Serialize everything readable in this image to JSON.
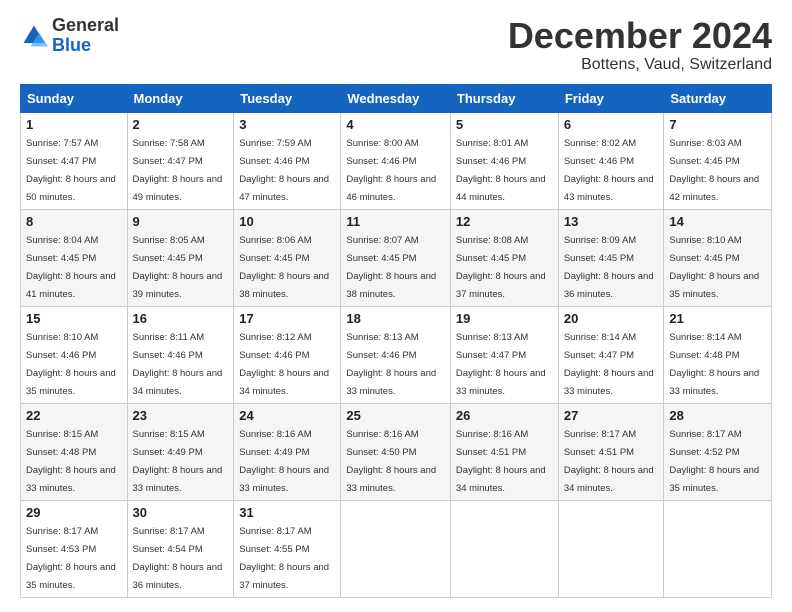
{
  "logo": {
    "general": "General",
    "blue": "Blue"
  },
  "title": {
    "month": "December 2024",
    "location": "Bottens, Vaud, Switzerland"
  },
  "weekdays": [
    "Sunday",
    "Monday",
    "Tuesday",
    "Wednesday",
    "Thursday",
    "Friday",
    "Saturday"
  ],
  "weeks": [
    [
      {
        "day": "1",
        "sunrise": "Sunrise: 7:57 AM",
        "sunset": "Sunset: 4:47 PM",
        "daylight": "Daylight: 8 hours and 50 minutes."
      },
      {
        "day": "2",
        "sunrise": "Sunrise: 7:58 AM",
        "sunset": "Sunset: 4:47 PM",
        "daylight": "Daylight: 8 hours and 49 minutes."
      },
      {
        "day": "3",
        "sunrise": "Sunrise: 7:59 AM",
        "sunset": "Sunset: 4:46 PM",
        "daylight": "Daylight: 8 hours and 47 minutes."
      },
      {
        "day": "4",
        "sunrise": "Sunrise: 8:00 AM",
        "sunset": "Sunset: 4:46 PM",
        "daylight": "Daylight: 8 hours and 46 minutes."
      },
      {
        "day": "5",
        "sunrise": "Sunrise: 8:01 AM",
        "sunset": "Sunset: 4:46 PM",
        "daylight": "Daylight: 8 hours and 44 minutes."
      },
      {
        "day": "6",
        "sunrise": "Sunrise: 8:02 AM",
        "sunset": "Sunset: 4:46 PM",
        "daylight": "Daylight: 8 hours and 43 minutes."
      },
      {
        "day": "7",
        "sunrise": "Sunrise: 8:03 AM",
        "sunset": "Sunset: 4:45 PM",
        "daylight": "Daylight: 8 hours and 42 minutes."
      }
    ],
    [
      {
        "day": "8",
        "sunrise": "Sunrise: 8:04 AM",
        "sunset": "Sunset: 4:45 PM",
        "daylight": "Daylight: 8 hours and 41 minutes."
      },
      {
        "day": "9",
        "sunrise": "Sunrise: 8:05 AM",
        "sunset": "Sunset: 4:45 PM",
        "daylight": "Daylight: 8 hours and 39 minutes."
      },
      {
        "day": "10",
        "sunrise": "Sunrise: 8:06 AM",
        "sunset": "Sunset: 4:45 PM",
        "daylight": "Daylight: 8 hours and 38 minutes."
      },
      {
        "day": "11",
        "sunrise": "Sunrise: 8:07 AM",
        "sunset": "Sunset: 4:45 PM",
        "daylight": "Daylight: 8 hours and 38 minutes."
      },
      {
        "day": "12",
        "sunrise": "Sunrise: 8:08 AM",
        "sunset": "Sunset: 4:45 PM",
        "daylight": "Daylight: 8 hours and 37 minutes."
      },
      {
        "day": "13",
        "sunrise": "Sunrise: 8:09 AM",
        "sunset": "Sunset: 4:45 PM",
        "daylight": "Daylight: 8 hours and 36 minutes."
      },
      {
        "day": "14",
        "sunrise": "Sunrise: 8:10 AM",
        "sunset": "Sunset: 4:45 PM",
        "daylight": "Daylight: 8 hours and 35 minutes."
      }
    ],
    [
      {
        "day": "15",
        "sunrise": "Sunrise: 8:10 AM",
        "sunset": "Sunset: 4:46 PM",
        "daylight": "Daylight: 8 hours and 35 minutes."
      },
      {
        "day": "16",
        "sunrise": "Sunrise: 8:11 AM",
        "sunset": "Sunset: 4:46 PM",
        "daylight": "Daylight: 8 hours and 34 minutes."
      },
      {
        "day": "17",
        "sunrise": "Sunrise: 8:12 AM",
        "sunset": "Sunset: 4:46 PM",
        "daylight": "Daylight: 8 hours and 34 minutes."
      },
      {
        "day": "18",
        "sunrise": "Sunrise: 8:13 AM",
        "sunset": "Sunset: 4:46 PM",
        "daylight": "Daylight: 8 hours and 33 minutes."
      },
      {
        "day": "19",
        "sunrise": "Sunrise: 8:13 AM",
        "sunset": "Sunset: 4:47 PM",
        "daylight": "Daylight: 8 hours and 33 minutes."
      },
      {
        "day": "20",
        "sunrise": "Sunrise: 8:14 AM",
        "sunset": "Sunset: 4:47 PM",
        "daylight": "Daylight: 8 hours and 33 minutes."
      },
      {
        "day": "21",
        "sunrise": "Sunrise: 8:14 AM",
        "sunset": "Sunset: 4:48 PM",
        "daylight": "Daylight: 8 hours and 33 minutes."
      }
    ],
    [
      {
        "day": "22",
        "sunrise": "Sunrise: 8:15 AM",
        "sunset": "Sunset: 4:48 PM",
        "daylight": "Daylight: 8 hours and 33 minutes."
      },
      {
        "day": "23",
        "sunrise": "Sunrise: 8:15 AM",
        "sunset": "Sunset: 4:49 PM",
        "daylight": "Daylight: 8 hours and 33 minutes."
      },
      {
        "day": "24",
        "sunrise": "Sunrise: 8:16 AM",
        "sunset": "Sunset: 4:49 PM",
        "daylight": "Daylight: 8 hours and 33 minutes."
      },
      {
        "day": "25",
        "sunrise": "Sunrise: 8:16 AM",
        "sunset": "Sunset: 4:50 PM",
        "daylight": "Daylight: 8 hours and 33 minutes."
      },
      {
        "day": "26",
        "sunrise": "Sunrise: 8:16 AM",
        "sunset": "Sunset: 4:51 PM",
        "daylight": "Daylight: 8 hours and 34 minutes."
      },
      {
        "day": "27",
        "sunrise": "Sunrise: 8:17 AM",
        "sunset": "Sunset: 4:51 PM",
        "daylight": "Daylight: 8 hours and 34 minutes."
      },
      {
        "day": "28",
        "sunrise": "Sunrise: 8:17 AM",
        "sunset": "Sunset: 4:52 PM",
        "daylight": "Daylight: 8 hours and 35 minutes."
      }
    ],
    [
      {
        "day": "29",
        "sunrise": "Sunrise: 8:17 AM",
        "sunset": "Sunset: 4:53 PM",
        "daylight": "Daylight: 8 hours and 35 minutes."
      },
      {
        "day": "30",
        "sunrise": "Sunrise: 8:17 AM",
        "sunset": "Sunset: 4:54 PM",
        "daylight": "Daylight: 8 hours and 36 minutes."
      },
      {
        "day": "31",
        "sunrise": "Sunrise: 8:17 AM",
        "sunset": "Sunset: 4:55 PM",
        "daylight": "Daylight: 8 hours and 37 minutes."
      },
      null,
      null,
      null,
      null
    ]
  ]
}
